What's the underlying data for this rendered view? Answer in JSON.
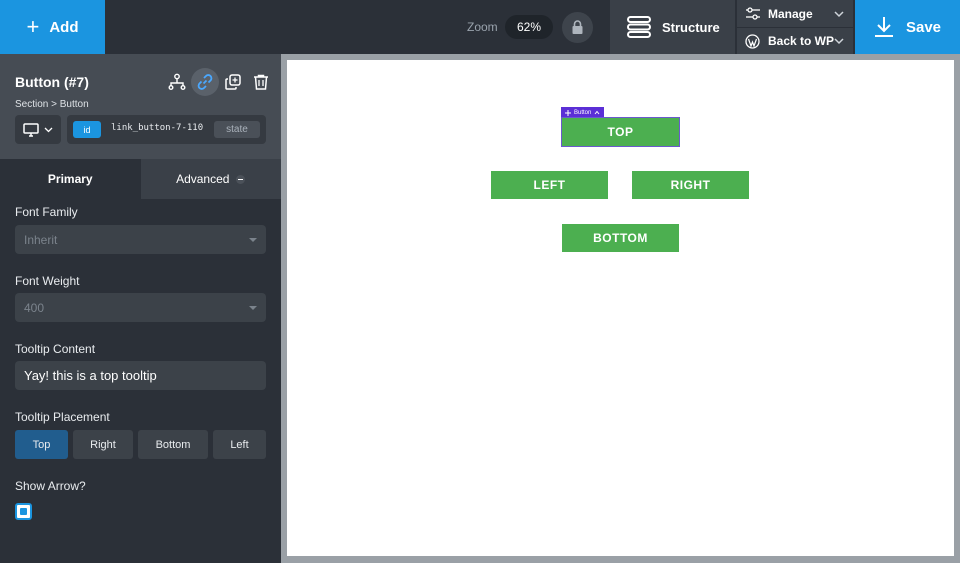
{
  "topbar": {
    "add_label": "Add",
    "zoom_label": "Zoom",
    "zoom_value": "62%",
    "structure_label": "Structure",
    "manage_label": "Manage",
    "back_label": "Back to WP",
    "save_label": "Save"
  },
  "element": {
    "title": "Button (#7)",
    "breadcrumb": "Section > Button",
    "id_badge": "id",
    "id_value": "link_button-7-110",
    "state_label": "state"
  },
  "tabs": {
    "primary": "Primary",
    "advanced": "Advanced"
  },
  "fields": {
    "font_family_label": "Font Family",
    "font_family_value": "Inherit",
    "font_weight_label": "Font Weight",
    "font_weight_value": "400",
    "tooltip_content_label": "Tooltip Content",
    "tooltip_content_value": "Yay! this is a top tooltip",
    "tooltip_placement_label": "Tooltip Placement",
    "placement_options": [
      "Top",
      "Right",
      "Bottom",
      "Left"
    ],
    "placement_selected": "Top",
    "show_arrow_label": "Show Arrow?",
    "show_arrow_checked": true
  },
  "canvas": {
    "selected_tag": "Button",
    "buttons": {
      "top": "TOP",
      "left": "LEFT",
      "right": "RIGHT",
      "bottom": "BOTTOM"
    }
  },
  "colors": {
    "accent": "#1b95e0",
    "button_green": "#4caf50",
    "selection": "#5b2fd6"
  }
}
